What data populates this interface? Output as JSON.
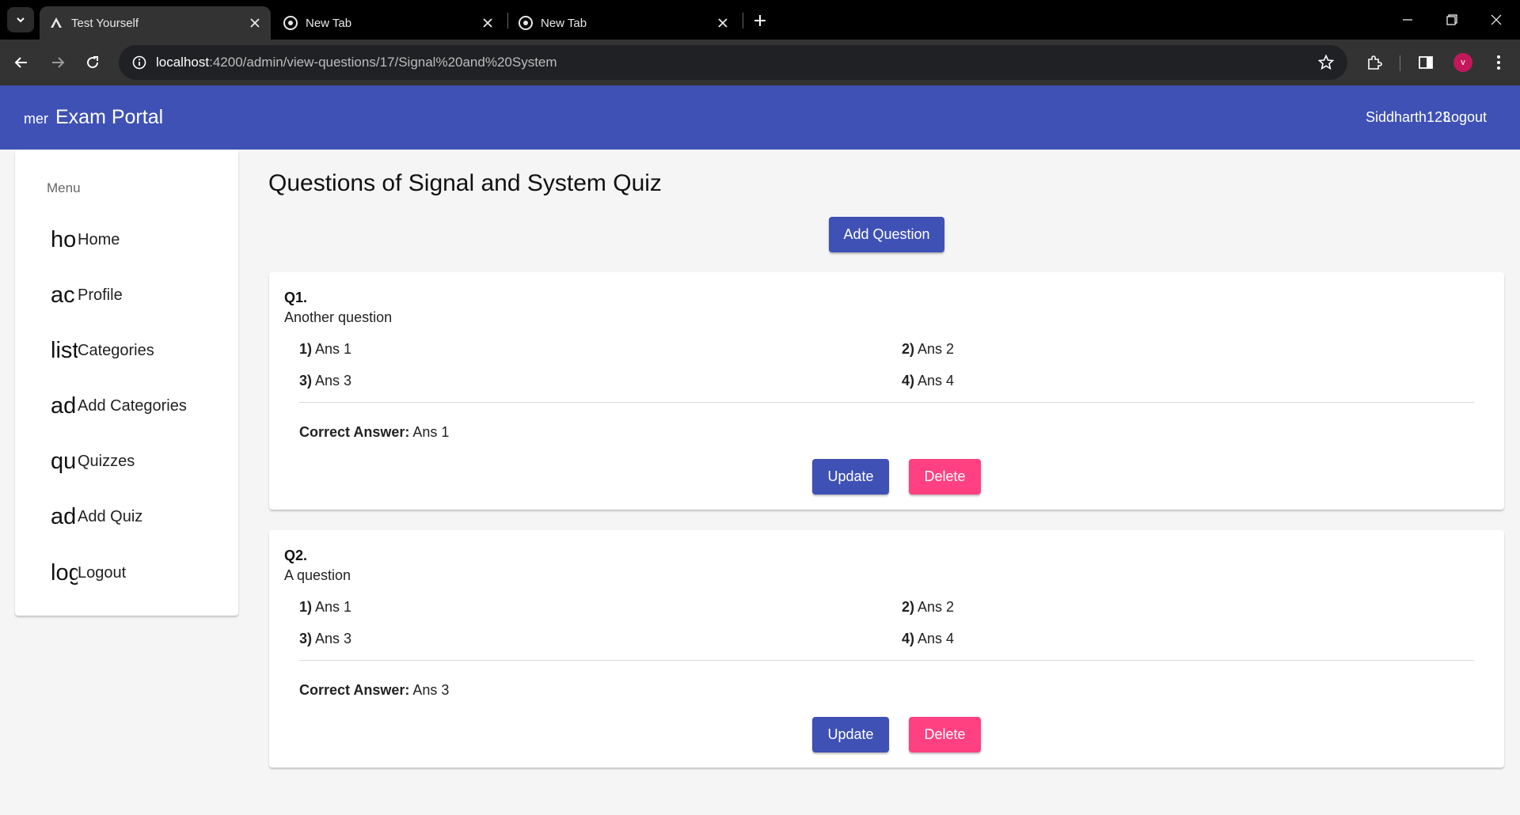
{
  "browser": {
    "tabs": [
      {
        "title": "Test Yourself",
        "active": true
      },
      {
        "title": "New Tab",
        "active": false
      },
      {
        "title": "New Tab",
        "active": false
      }
    ],
    "url_host": "localhost",
    "url_rest": ":4200/admin/view-questions/17/Signal%20and%20System",
    "profile_initial": "v"
  },
  "appbar": {
    "menu_glyph": "mer",
    "brand": "Exam Portal",
    "username": "Siddharth123",
    "logout": "Logout",
    "color": "#3f51b5"
  },
  "sidebar": {
    "title": "Menu",
    "items": [
      {
        "icon": "ho",
        "label": "Home"
      },
      {
        "icon": "ac",
        "label": "Profile"
      },
      {
        "icon": "list",
        "label": "Categories"
      },
      {
        "icon": "ad",
        "label": "Add Categories"
      },
      {
        "icon": "qu",
        "label": "Quizzes"
      },
      {
        "icon": "ad",
        "label": "Add Quiz"
      },
      {
        "icon": "log",
        "label": "Logout"
      }
    ]
  },
  "main": {
    "title": "Questions of Signal and System Quiz",
    "add_button": "Add Question",
    "correct_label": "Correct Answer:",
    "update_label": "Update",
    "delete_label": "Delete",
    "questions": [
      {
        "num": "Q1.",
        "text": "Another question",
        "options": [
          {
            "n": "1)",
            "text": "Ans 1"
          },
          {
            "n": "2)",
            "text": "Ans 2"
          },
          {
            "n": "3)",
            "text": "Ans 3"
          },
          {
            "n": "4)",
            "text": "Ans 4"
          }
        ],
        "answer": "Ans 1"
      },
      {
        "num": "Q2.",
        "text": "A question",
        "options": [
          {
            "n": "1)",
            "text": "Ans 1"
          },
          {
            "n": "2)",
            "text": "Ans 2"
          },
          {
            "n": "3)",
            "text": "Ans 3"
          },
          {
            "n": "4)",
            "text": "Ans 4"
          }
        ],
        "answer": "Ans 3"
      }
    ]
  },
  "colors": {
    "primary": "#3f51b5",
    "warn": "#ff4081"
  }
}
